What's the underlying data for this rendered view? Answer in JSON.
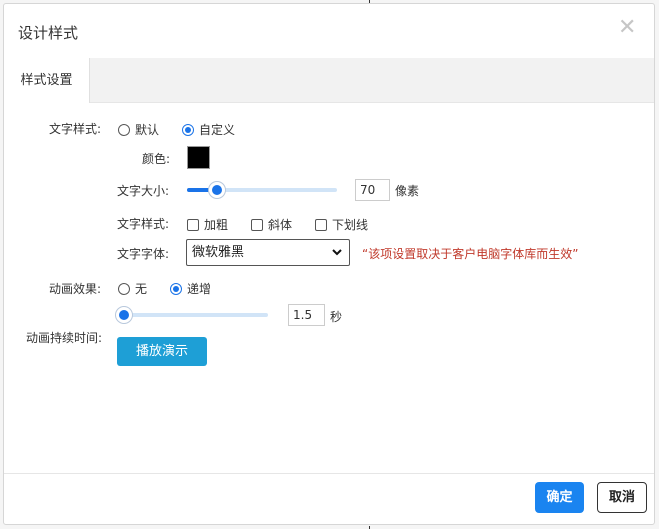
{
  "dialog": {
    "title": "设计样式",
    "close_icon": "close-icon"
  },
  "tabs": [
    {
      "label": "样式设置",
      "active": true
    }
  ],
  "text_style": {
    "label": "文字样式:",
    "options": [
      {
        "label": "默认",
        "selected": false
      },
      {
        "label": "自定义",
        "selected": true
      }
    ]
  },
  "color": {
    "label": "颜色:",
    "value": "#000000"
  },
  "font_size": {
    "label": "文字大小:",
    "value": "70",
    "unit": "像素",
    "slider_fraction": 0.2
  },
  "text_decoration": {
    "label": "文字样式:",
    "options": [
      {
        "label": "加粗",
        "checked": false
      },
      {
        "label": "斜体",
        "checked": false
      },
      {
        "label": "下划线",
        "checked": false
      }
    ]
  },
  "font_family": {
    "label": "文字字体:",
    "value": "微软雅黑",
    "note": "“该项设置取决于客户电脑字体库而生效”"
  },
  "animation": {
    "label": "动画效果:",
    "options": [
      {
        "label": "无",
        "selected": false
      },
      {
        "label": "递增",
        "selected": true
      }
    ],
    "duration_label": "动画持续时间:",
    "duration_value": "1.5",
    "duration_unit": "秒",
    "slider_fraction": 0.0,
    "play_button": "播放演示"
  },
  "footer": {
    "ok": "确定",
    "cancel": "取消"
  },
  "colors": {
    "primary": "#1a73e8",
    "play_button": "#1e9fd6",
    "note": "#c0392b"
  }
}
